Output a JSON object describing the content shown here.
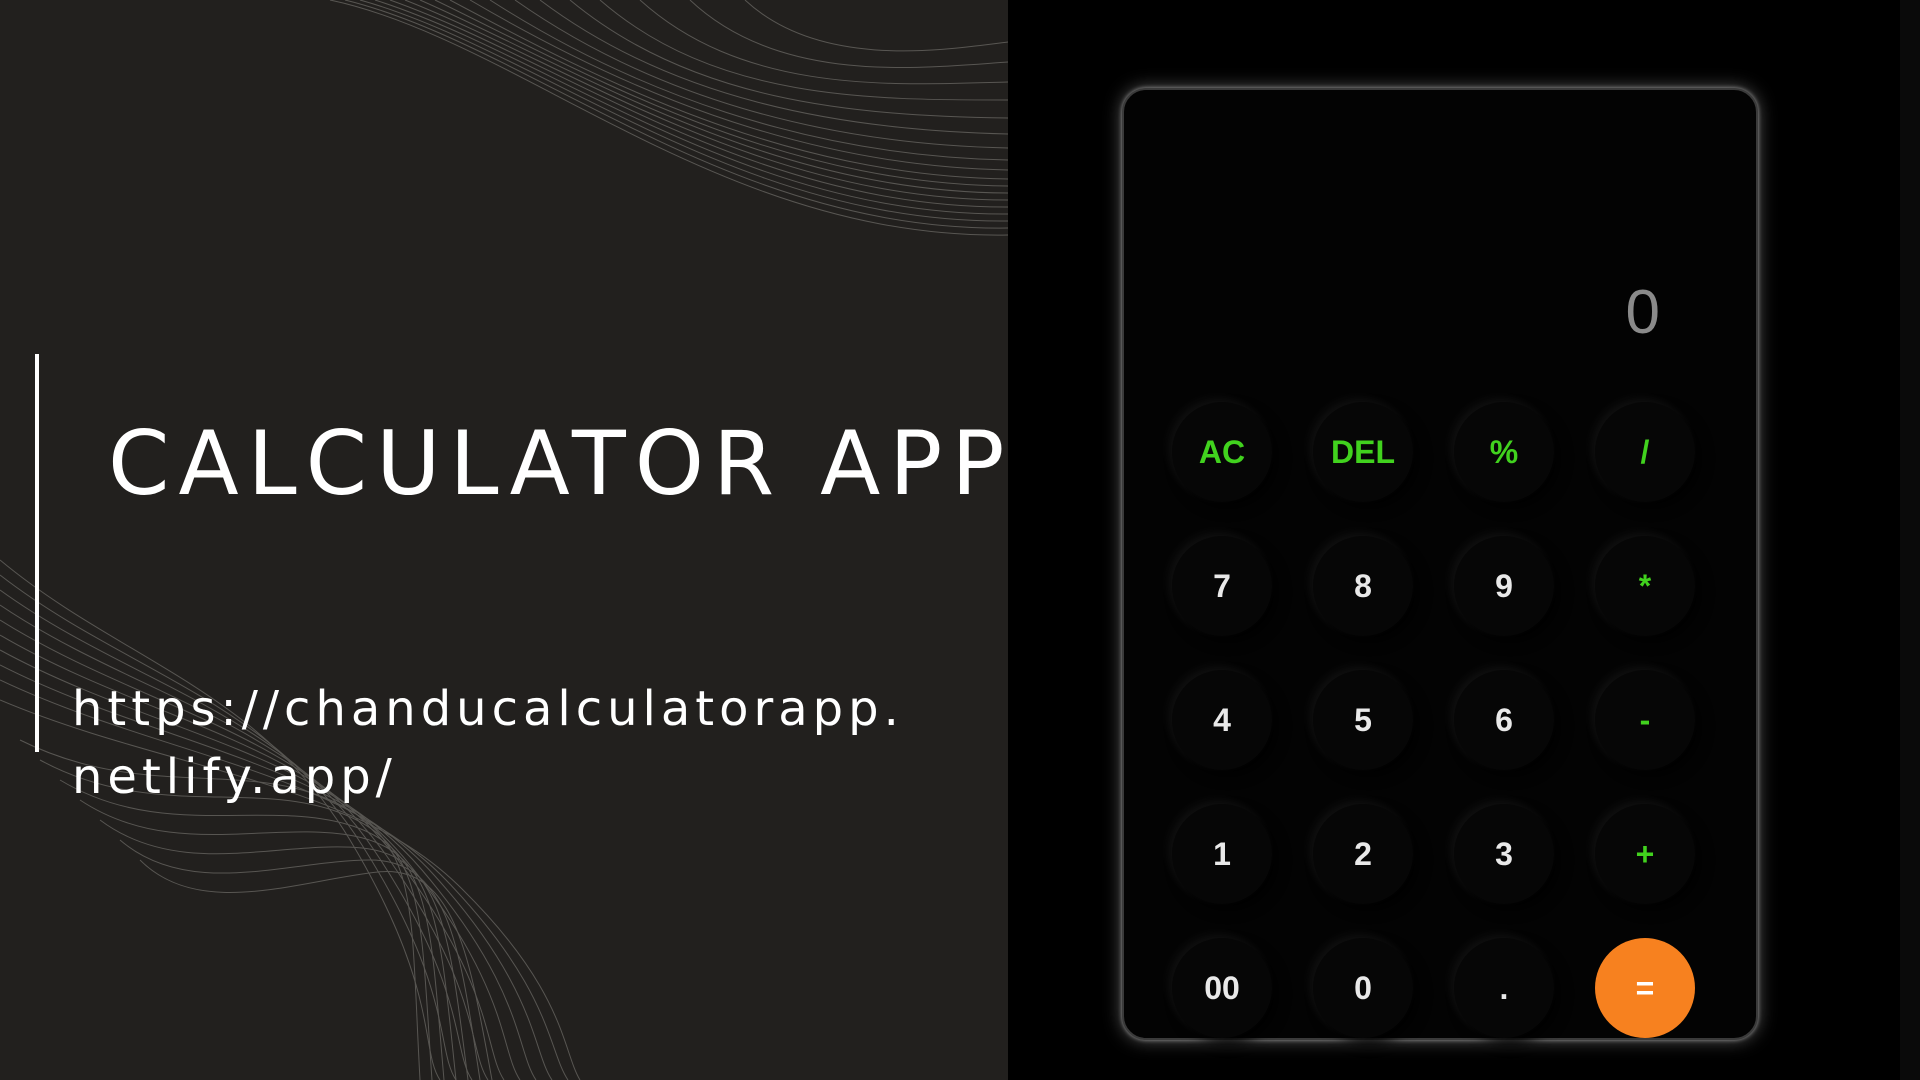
{
  "slide": {
    "title": "CALCULATOR APP",
    "url_line1": "https://chanducalculatorapp.",
    "url_line2": "netlify.app/"
  },
  "calculator": {
    "display_value": "0",
    "keys": {
      "ac": "AC",
      "del": "DEL",
      "percent": "%",
      "divide": "/",
      "seven": "7",
      "eight": "8",
      "nine": "9",
      "multiply": "*",
      "four": "4",
      "five": "5",
      "six": "6",
      "minus": "-",
      "one": "1",
      "two": "2",
      "three": "3",
      "plus": "+",
      "double_zero": "00",
      "zero": "0",
      "decimal": ".",
      "equals": "="
    }
  },
  "colors": {
    "left_background": "#22201e",
    "right_background": "#000000",
    "operator_text": "#41d21e",
    "equals_button": "#f7811f",
    "display_text": "#8a8a8a"
  }
}
